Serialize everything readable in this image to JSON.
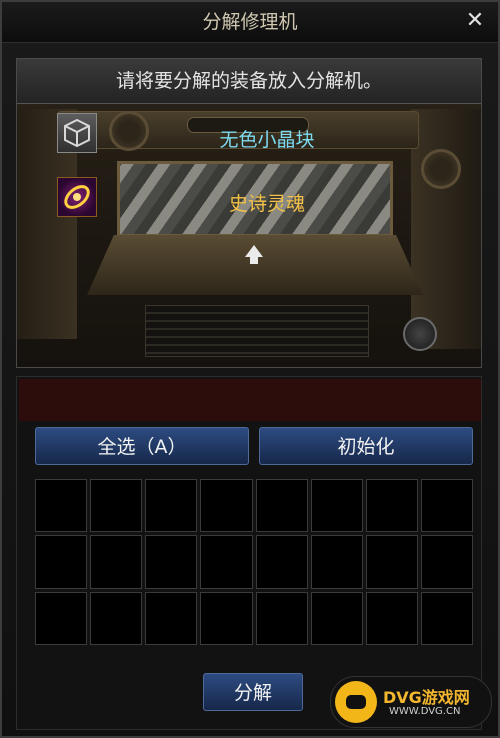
{
  "window": {
    "title": "分解修理机",
    "close_symbol": "✕"
  },
  "machine": {
    "instruction": "请将要分解的装备放入分解机。",
    "materials": [
      {
        "name": "无色小晶块",
        "icon": "colorless-crystal-cube-icon",
        "color": "#7ddaf0"
      },
      {
        "name": "史诗灵魂",
        "icon": "epic-soul-icon",
        "color": "#f4c246"
      }
    ]
  },
  "inventory": {
    "select_all_label": "全选（A）",
    "reset_label": "初始化",
    "slots": 24
  },
  "footer": {
    "decompose_label": "分解"
  },
  "watermark": {
    "title": "DVG游戏网",
    "subtitle": "WWW.DVG.CN"
  },
  "colors": {
    "accent_blue": "#2d4c81",
    "gold": "#f4c246",
    "cyan": "#7ddaf0"
  }
}
